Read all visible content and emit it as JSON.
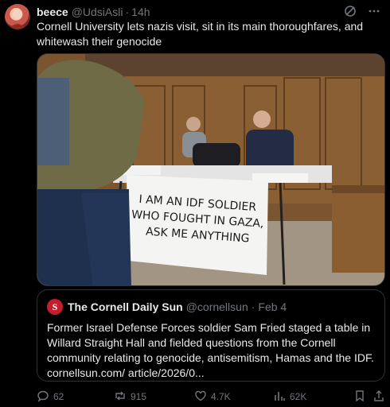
{
  "tweet": {
    "display_name": "beece",
    "handle": "@UdsiAsli",
    "separator": "·",
    "time": "14h",
    "text": "Cornell University lets nazis visit, sit in its main thoroughfares, and whitewash their genocide"
  },
  "media": {
    "sign_line1": "I AM AN IDF SOLDIER",
    "sign_line2": "WHO FOUGHT IN GAZA,",
    "sign_line3": "ASK ME ANYTHING"
  },
  "quote": {
    "logo_letter": "S",
    "display_name": "The Cornell Daily Sun",
    "handle": "@cornellsun",
    "separator": "·",
    "date": "Feb 4",
    "text": "Former Israel Defense Forces soldier Sam Fried staged a table in Willard Straight Hall and fielded questions from the Cornell community relating to genocide, antisemitism, Hamas and the IDF. cornellsun.com/ article/2026/0..."
  },
  "actions": {
    "replies": "62",
    "reposts": "915",
    "likes": "4.7K",
    "views": "62K"
  },
  "colors": {
    "background": "#000000",
    "text": "#e7e9ea",
    "muted": "#71767b",
    "border": "#2f3336",
    "logo_red": "#c41d2e"
  },
  "icons": [
    "grok-icon",
    "more-icon",
    "reply-icon",
    "repost-icon",
    "like-icon",
    "views-icon",
    "bookmark-icon",
    "share-icon"
  ]
}
